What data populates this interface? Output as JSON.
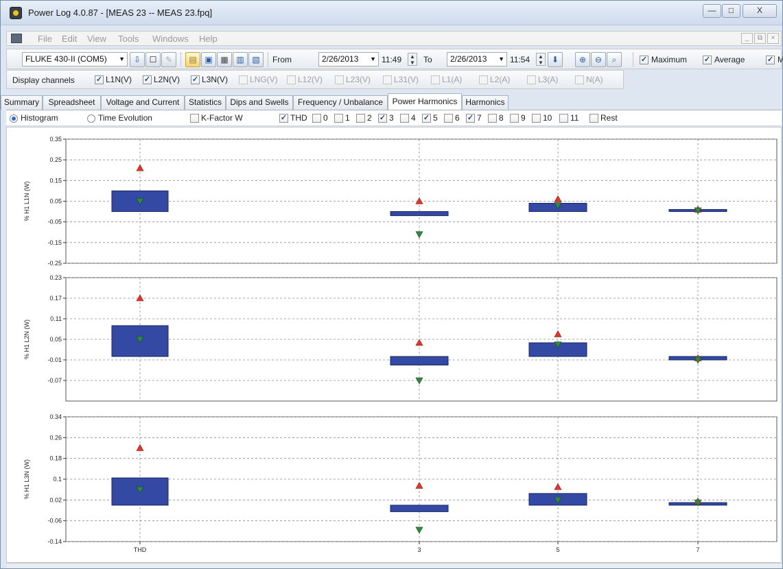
{
  "window": {
    "title": "Power Log 4.0.87 - [MEAS 23 -- MEAS 23.fpq]",
    "minimize": "—",
    "maximize": "□",
    "close": "X"
  },
  "menu": {
    "items": [
      "File",
      "Edit",
      "View",
      "Tools",
      "Windows",
      "Help"
    ],
    "mdi_minimize": "_",
    "mdi_restore": "⧉",
    "mdi_close": "×"
  },
  "toolbar": {
    "device": "FLUKE 430-II (COM5)",
    "from_label": "From",
    "from_date": "2/26/2013",
    "from_time": "11:49",
    "to_label": "To",
    "to_date": "2/26/2013",
    "to_time": "11:54",
    "maximum_label": "Maximum",
    "average_label": "Average",
    "minimum_label": "M"
  },
  "channels": {
    "label": "Display channels",
    "items": [
      {
        "name": "L1N(V)",
        "checked": true,
        "enabled": true
      },
      {
        "name": "L2N(V)",
        "checked": true,
        "enabled": true
      },
      {
        "name": "L3N(V)",
        "checked": true,
        "enabled": true
      },
      {
        "name": "LNG(V)",
        "checked": false,
        "enabled": false
      },
      {
        "name": "L12(V)",
        "checked": false,
        "enabled": false
      },
      {
        "name": "L23(V)",
        "checked": false,
        "enabled": false
      },
      {
        "name": "L31(V)",
        "checked": false,
        "enabled": false
      },
      {
        "name": "L1(A)",
        "checked": false,
        "enabled": false
      },
      {
        "name": "L2(A)",
        "checked": false,
        "enabled": false
      },
      {
        "name": "L3(A)",
        "checked": false,
        "enabled": false
      },
      {
        "name": "N(A)",
        "checked": false,
        "enabled": false
      }
    ]
  },
  "tabs": [
    {
      "label": "Summary",
      "active": false
    },
    {
      "label": "Spreadsheet",
      "active": false
    },
    {
      "label": "Voltage and Current",
      "active": false
    },
    {
      "label": "Statistics",
      "active": false
    },
    {
      "label": "Dips and Swells",
      "active": false
    },
    {
      "label": "Frequency / Unbalance",
      "active": false
    },
    {
      "label": "Power Harmonics",
      "active": true
    },
    {
      "label": "Harmonics",
      "active": false
    }
  ],
  "options": {
    "histogram_label": "Histogram",
    "time_evolution_label": "Time Evolution",
    "kfactor_label": "K-Factor W",
    "harmonic_checks": [
      {
        "label": "THD",
        "checked": true
      },
      {
        "label": "0",
        "checked": false
      },
      {
        "label": "1",
        "checked": false
      },
      {
        "label": "2",
        "checked": false
      },
      {
        "label": "3",
        "checked": true
      },
      {
        "label": "4",
        "checked": false
      },
      {
        "label": "5",
        "checked": true
      },
      {
        "label": "6",
        "checked": false
      },
      {
        "label": "7",
        "checked": true
      },
      {
        "label": "8",
        "checked": false
      },
      {
        "label": "9",
        "checked": false
      },
      {
        "label": "10",
        "checked": false
      },
      {
        "label": "11",
        "checked": false
      },
      {
        "label": "Rest",
        "checked": false
      }
    ]
  },
  "chart_data": [
    {
      "type": "bar",
      "ylabel": "% H1 L1N (W)",
      "categories": [
        "THD",
        "3",
        "5",
        "7"
      ],
      "yticks": [
        "0.35",
        "0.25",
        "0.15",
        "0.05",
        "-0.05",
        "-0.15",
        "-0.25"
      ],
      "ylim": [
        -0.25,
        0.35
      ],
      "series": [
        {
          "name": "Average",
          "values": [
            0.1,
            -0.02,
            0.04,
            0.005
          ]
        },
        {
          "name": "Maximum",
          "values": [
            0.21,
            0.05,
            0.06,
            0.01
          ]
        },
        {
          "name": "Minimum",
          "values": [
            0.05,
            -0.11,
            0.03,
            0.005
          ]
        }
      ]
    },
    {
      "type": "bar",
      "ylabel": "% H1 L2N (W)",
      "categories": [
        "THD",
        "3",
        "5",
        "7"
      ],
      "yticks": [
        "0.23",
        "0.17",
        "0.11",
        "0.05",
        "-0.01",
        "-0.07"
      ],
      "ylim": [
        -0.13,
        0.23
      ],
      "series": [
        {
          "name": "Average",
          "values": [
            0.09,
            -0.025,
            0.04,
            -0.01
          ]
        },
        {
          "name": "Maximum",
          "values": [
            0.17,
            0.04,
            0.065,
            -0.005
          ]
        },
        {
          "name": "Minimum",
          "values": [
            0.05,
            -0.07,
            0.035,
            -0.01
          ]
        }
      ]
    },
    {
      "type": "bar",
      "ylabel": "% H1 L3N (W)",
      "categories": [
        "THD",
        "3",
        "5",
        "7"
      ],
      "yticks": [
        "0.34",
        "0.26",
        "0.18",
        "0.1",
        "0.02",
        "-0.06",
        "-0.14"
      ],
      "ylim": [
        -0.14,
        0.34
      ],
      "series": [
        {
          "name": "Average",
          "values": [
            0.105,
            -0.025,
            0.045,
            0.01
          ]
        },
        {
          "name": "Maximum",
          "values": [
            0.22,
            0.075,
            0.07,
            0.015
          ]
        },
        {
          "name": "Minimum",
          "values": [
            0.06,
            -0.095,
            0.02,
            0.01
          ]
        }
      ]
    }
  ],
  "colors": {
    "bar_fill": "#3349a3",
    "bar_stroke": "#1a2660",
    "max_marker": "#e0362c",
    "min_marker": "#2f8a3e",
    "grid": "#8a8a8a"
  }
}
